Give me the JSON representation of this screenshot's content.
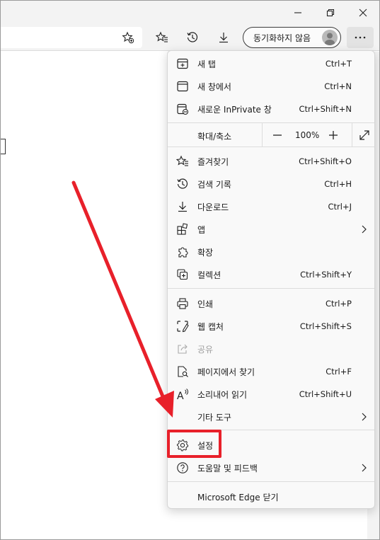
{
  "window": {
    "minimize_icon": "minimize-icon",
    "restore_icon": "restore-icon",
    "close_icon": "close-icon"
  },
  "toolbar": {
    "sync_label": "동기화하지 않음",
    "more_icon": "more-icon"
  },
  "menu": {
    "items": [
      {
        "label": "새 탭",
        "shortcut": "Ctrl+T",
        "icon": "new-tab-icon"
      },
      {
        "label": "새 창에서",
        "shortcut": "Ctrl+N",
        "icon": "new-window-icon"
      },
      {
        "label": "새로운 InPrivate 창",
        "shortcut": "Ctrl+Shift+N",
        "icon": "inprivate-icon"
      },
      {
        "label": "즐겨찾기",
        "shortcut": "Ctrl+Shift+O",
        "icon": "favorites-icon"
      },
      {
        "label": "검색 기록",
        "shortcut": "Ctrl+H",
        "icon": "history-icon"
      },
      {
        "label": "다운로드",
        "shortcut": "Ctrl+J",
        "icon": "download-icon"
      },
      {
        "label": "앱",
        "shortcut": "",
        "icon": "apps-icon"
      },
      {
        "label": "확장",
        "shortcut": "",
        "icon": "extensions-icon"
      },
      {
        "label": "컬렉션",
        "shortcut": "Ctrl+Shift+Y",
        "icon": "collections-icon"
      },
      {
        "label": "인쇄",
        "shortcut": "Ctrl+P",
        "icon": "print-icon"
      },
      {
        "label": "웹 캡처",
        "shortcut": "Ctrl+Shift+S",
        "icon": "web-capture-icon"
      },
      {
        "label": "공유",
        "shortcut": "",
        "icon": "share-icon"
      },
      {
        "label": "페이지에서 찾기",
        "shortcut": "Ctrl+F",
        "icon": "find-icon"
      },
      {
        "label": "소리내어 읽기",
        "shortcut": "Ctrl+Shift+U",
        "icon": "read-aloud-icon"
      },
      {
        "label": "기타 도구",
        "shortcut": "",
        "icon": ""
      },
      {
        "label": "설정",
        "shortcut": "",
        "icon": "settings-icon"
      },
      {
        "label": "도움말 및 피드백",
        "shortcut": "",
        "icon": "help-icon"
      },
      {
        "label": "Microsoft Edge 닫기",
        "shortcut": "",
        "icon": ""
      }
    ],
    "zoom": {
      "label": "확대/축소",
      "value": "100%",
      "minus": "−",
      "plus": "+"
    }
  },
  "annotation": {
    "arrow_color": "#e8202a",
    "highlight_color": "#e8202a"
  }
}
